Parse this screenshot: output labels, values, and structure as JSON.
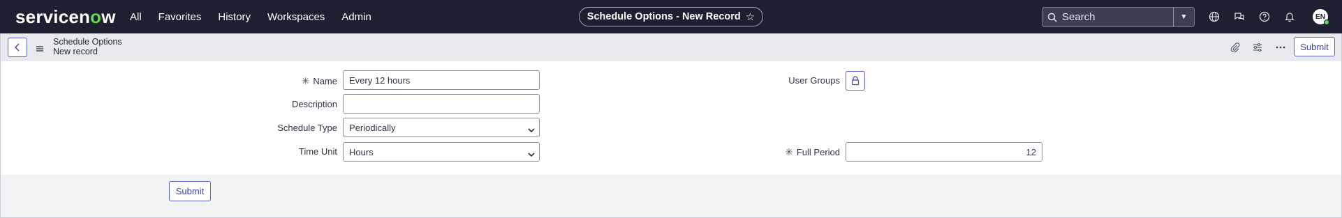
{
  "brand": {
    "logo_text_a": "servicen",
    "logo_text_o": "o",
    "logo_text_b": "w"
  },
  "nav": {
    "links": [
      "All",
      "Favorites",
      "History",
      "Workspaces",
      "Admin"
    ],
    "record_title": "Schedule Options - New Record",
    "star_icon": "star-outline-icon",
    "search_placeholder": "Search",
    "avatar_initials": "EN"
  },
  "form_header": {
    "table_label": "Schedule Options",
    "record_label": "New record",
    "submit_label": "Submit"
  },
  "fields": {
    "name": {
      "label": "Name",
      "value": "Every 12 hours",
      "required": true
    },
    "description": {
      "label": "Description",
      "value": ""
    },
    "schedule_type": {
      "label": "Schedule Type",
      "value": "Periodically"
    },
    "time_unit": {
      "label": "Time Unit",
      "value": "Hours"
    },
    "user_groups": {
      "label": "User Groups"
    },
    "full_period": {
      "label": "Full Period",
      "value": "12",
      "required": true
    }
  },
  "footer": {
    "submit_label": "Submit"
  },
  "colors": {
    "nav_bg": "#1e1f31",
    "accent": "#5d62c8",
    "brand_green": "#62d84e"
  }
}
